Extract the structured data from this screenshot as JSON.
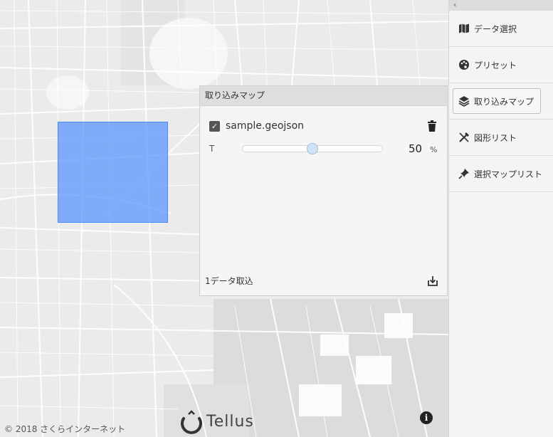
{
  "map": {
    "attribution": "© 2018 さくらインターネット",
    "logo_text": "Tellus",
    "info_label": "i"
  },
  "panel": {
    "title": "取り込みマップ",
    "layer": {
      "name": "sample.geojson",
      "checked": true,
      "opacity_label": "T",
      "opacity_value": "50",
      "opacity_unit": "%",
      "opacity_fraction": 0.5
    },
    "footer": "1データ取込"
  },
  "sidebar": {
    "collapse_glyph": "‹",
    "items": [
      {
        "label": "データ選択",
        "icon": "map-icon"
      },
      {
        "label": "プリセット",
        "icon": "palette-icon"
      },
      {
        "label": "取り込みマップ",
        "icon": "layers-icon",
        "active": true
      },
      {
        "label": "図形リスト",
        "icon": "draw-tools-icon"
      },
      {
        "label": "選択マップリスト",
        "icon": "pin-icon"
      }
    ]
  }
}
